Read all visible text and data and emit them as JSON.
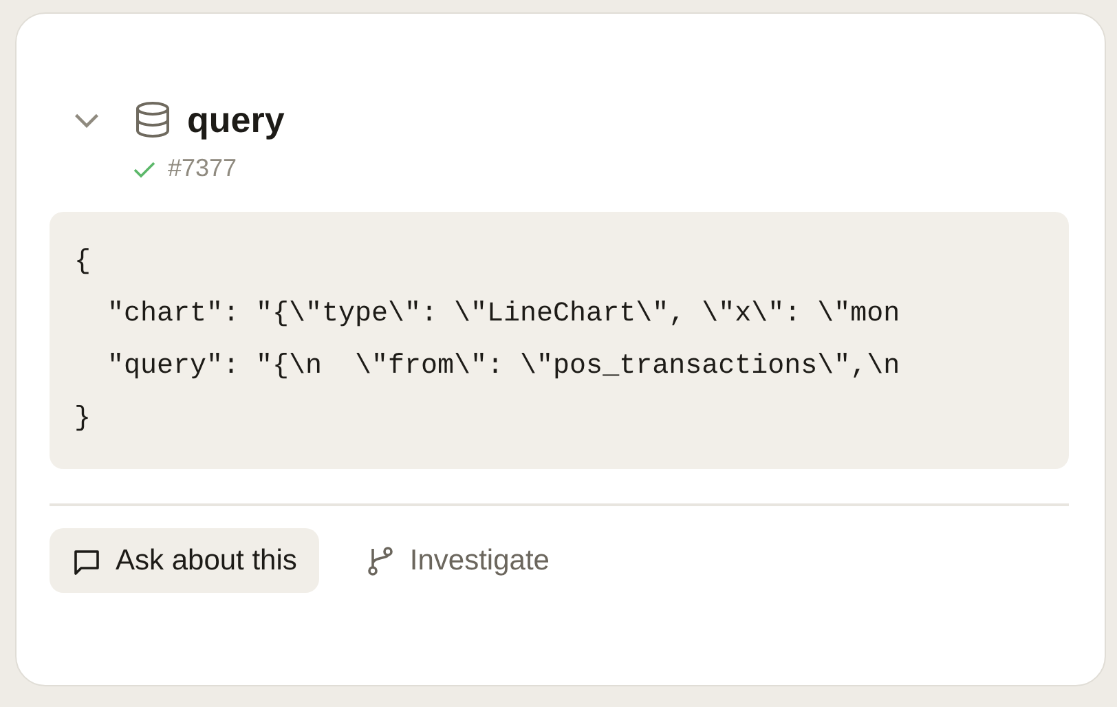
{
  "step": {
    "title": "query",
    "expanded": true,
    "succeeded": true,
    "run_id": "#7377"
  },
  "code_lines": [
    "{",
    "  \"chart\": \"{\\\"type\\\": \\\"LineChart\\\", \\\"x\\\": \\\"mon",
    "  \"query\": \"{\\n  \\\"from\\\": \\\"pos_transactions\\\",\\n",
    "}"
  ],
  "actions": [
    {
      "label": "Ask about this",
      "kind": "primary"
    },
    {
      "label": "Investigate",
      "kind": "secondary"
    }
  ]
}
